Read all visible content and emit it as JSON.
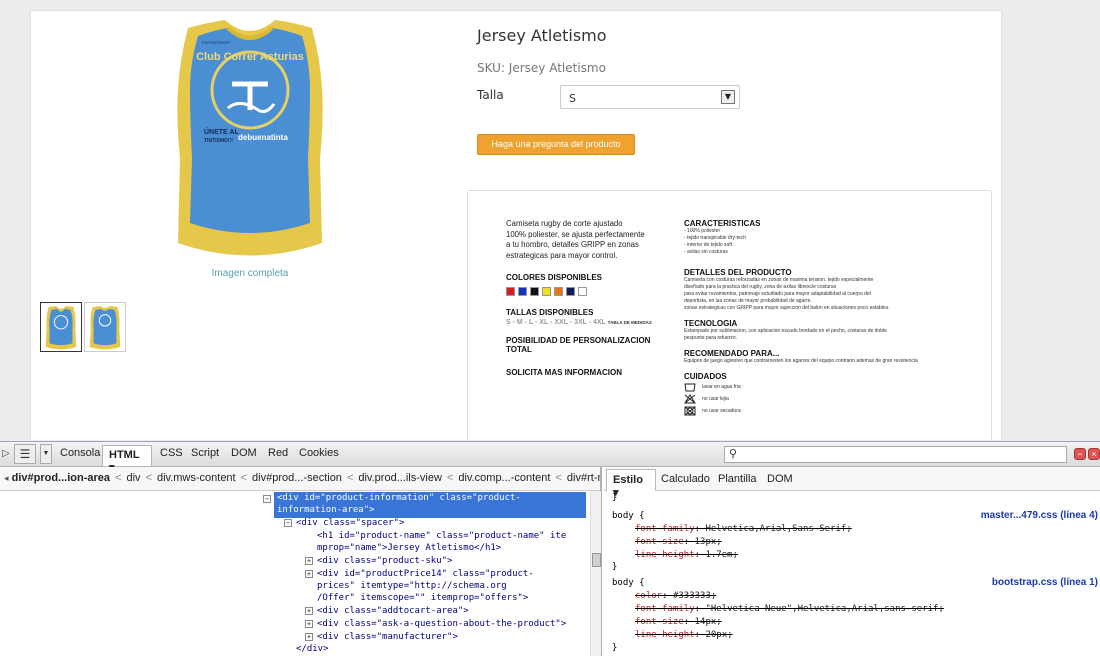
{
  "product": {
    "name": "Jersey Atletismo",
    "sku": "SKU: Jersey Atletismo",
    "size_label": "Talla",
    "size_value": "S",
    "ask_button": "Haga una pregunta del producto",
    "image_link": "Imagen completa",
    "jersey_logo_text": "Club Correr Asturias",
    "jersey_slogan": "ÚNETE AL",
    "jersey_slogan2": "TINTISMO!!!",
    "jersey_sponsor": "debuenatinta",
    "jersey_brand": "ESPORTSHOP"
  },
  "description": {
    "intro": "Camiseta rugby de corte ajustado\n100% poliester, se ajusta perfectamente\na tu hombro, detalles GRIPP en zonas\nestrategicas para mayor control.",
    "colors_title": "COLORES DISPONIBLES",
    "colors": [
      "#d21f26",
      "#1431b8",
      "#111111",
      "#f0e120",
      "#e07a18",
      "#0f1e5a",
      "#ffffff"
    ],
    "sizes_title": "TALLAS DISPONIBLES",
    "sizes": "S - M - L - XL - XXL - 3XL - 4XL",
    "sizes_table": "TABLA DE MEDIDAS",
    "personalization": "POSIBILIDAD DE PERSONALIZACION TOTAL",
    "more_info": "SOLICITA MAS INFORMACION",
    "features_title": "CARACTERISTICAS",
    "features": "- 100% poliester\n- tejido transpirable dry-tech\n- interior de tejido soft\n- axilas sin costuras",
    "details_title": "DETALLES DEL PRODUCTO",
    "details": "Camiseta con costuras reforzadas en zonas de maxima tension, tejido especialmente\ndiseñado para la practica del rugby, zona de axilas librescle costuras\npara evitar rozamientos, patronaje estudiado para mayor adaptabilidad al cuerpo del\ndeportista, en las zonas de mayor probabilidad de agarre.\nzonas estrategicas con GRIPP para mayor sujeccion del balon en situaciones poco estables.",
    "tech_title": "TECNOLOGIA",
    "tech": "Estampado por sublimacion, con aplicacion escudo bordado en el pecho, costuras de doble\npespunte para refuerzo.",
    "recommended_title": "RECOMENDADO PARA...",
    "recommended": "Equipos de juego agresivo que contrarresten los agarres  del equipo contrario ademas de gran resistencia",
    "care_title": "CUIDADOS",
    "care": [
      "lavar en agua fria",
      "no usar lejia",
      "no usar secadora"
    ]
  },
  "devtools": {
    "tabs": [
      "Consola",
      "HTML",
      "CSS",
      "Script",
      "DOM",
      "Red",
      "Cookies"
    ],
    "html_tab": "HTML ▾",
    "breadcrumb": [
      "div#prod...ion-area",
      "div",
      "div.mws-content",
      "div#prod...-section",
      "div.prod...ils-view",
      "div.comp...-content",
      "div#rt-m"
    ],
    "side_tabs": [
      "Estilo ▾",
      "Calculado",
      "Plantilla",
      "DOM"
    ],
    "html_lines": {
      "l1a": "<div id=\"product-information\" class=\"product-",
      "l1b": "information-area\">",
      "l2": "<div class=\"spacer\">",
      "l3a": "<h1 id=\"product-name\" class=\"product-name\" ite",
      "l3b": "mprop=\"name\">Jersey Atletismo</h1>",
      "l4": "<div class=\"product-sku\">",
      "l5a": "<div id=\"productPrice14\" class=\"product-",
      "l5b": "prices\" itemtype=\"http://schema.org",
      "l5c": "/Offer\" itemscope=\"\" itemprop=\"offers\">",
      "l6": "<div class=\"addtocart-area\">",
      "l7": "<div class=\"ask-a-question-about-the-product\">",
      "l8": "<div class=\"manufacturer\">",
      "l9": "</div>"
    },
    "css": {
      "close_brace": "}",
      "rule1_selector": "body {",
      "rule1_source": "master...479.css (línea 4)",
      "rule1_props": [
        {
          "name": "font-family",
          "value": "Helvetica,Arial,Sans-Serif;"
        },
        {
          "name": "font-size",
          "value": "13px;"
        },
        {
          "name": "line-height",
          "value": "1.7em;"
        }
      ],
      "rule2_selector": "body {",
      "rule2_source": "bootstrap.css (línea 1)",
      "rule2_props": [
        {
          "name": "color",
          "value": "#333333;"
        },
        {
          "name": "font-family",
          "value": "\"Helvetica Neue\",Helvetica,Arial,sans-serif;"
        },
        {
          "name": "font-size",
          "value": "14px;"
        },
        {
          "name": "line-height",
          "value": "20px;"
        }
      ]
    }
  }
}
